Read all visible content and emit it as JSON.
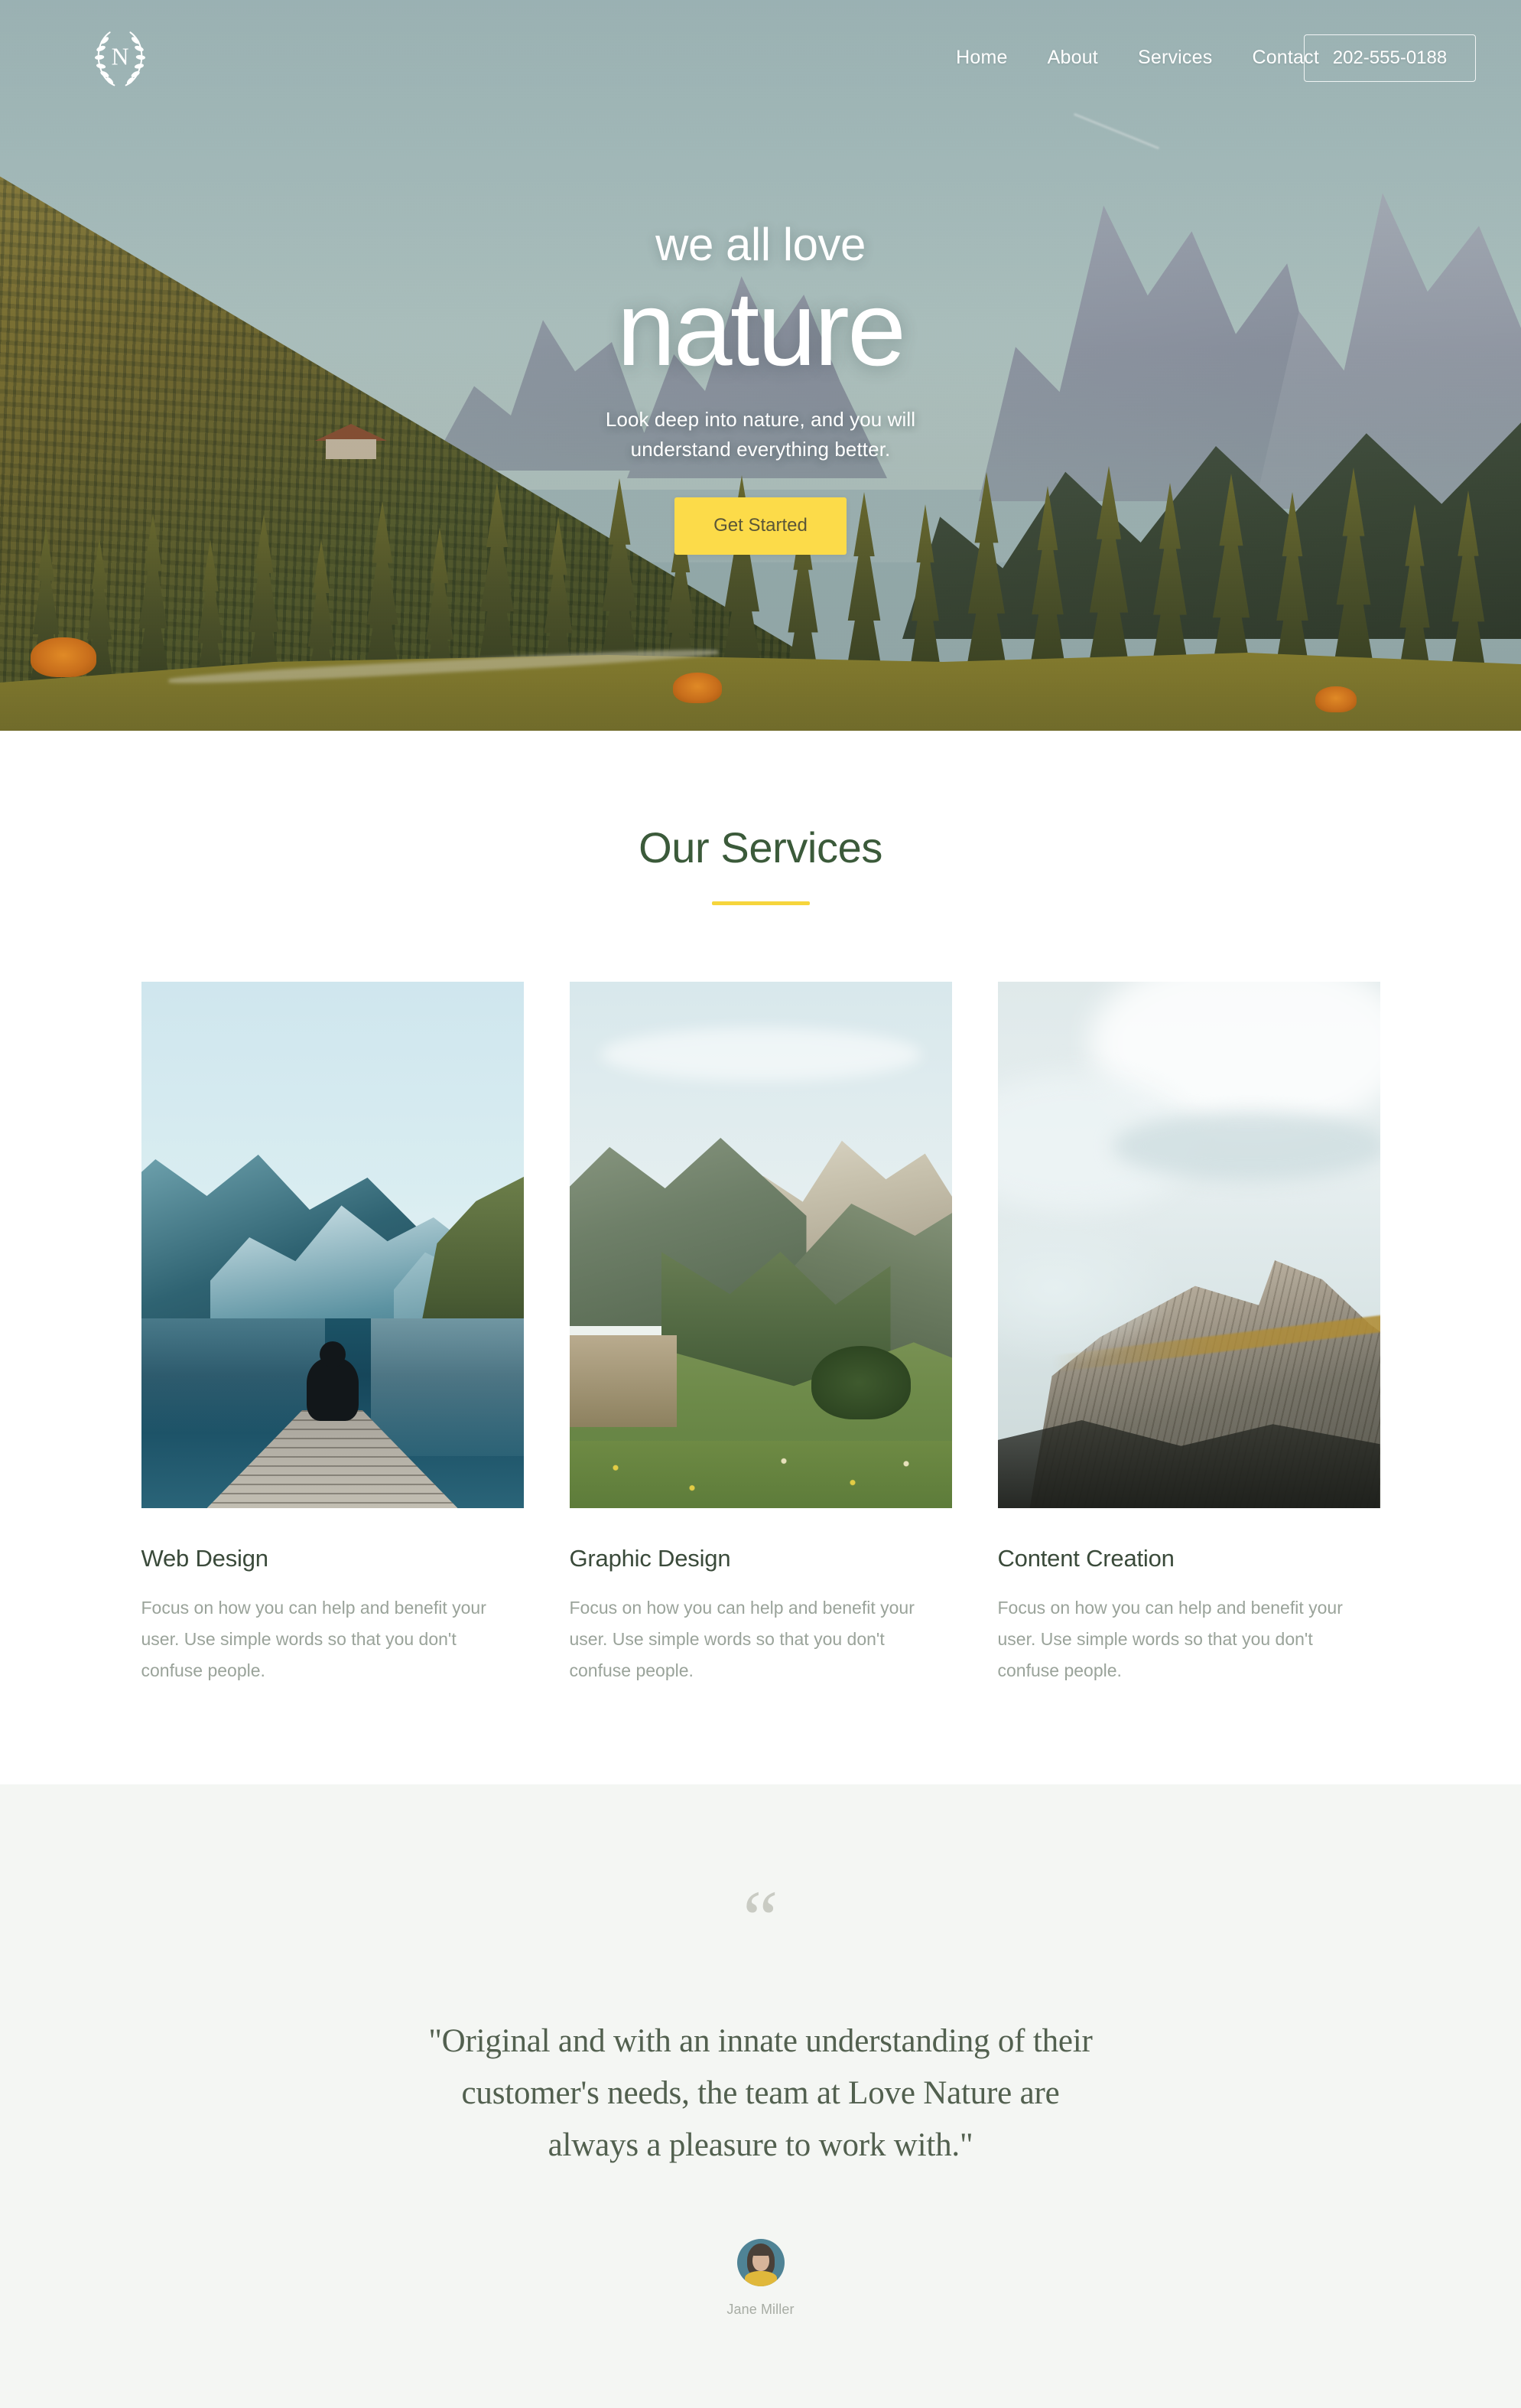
{
  "brand": {
    "logo_letter": "N",
    "logo_icon": "laurel-wreath-icon"
  },
  "nav": {
    "links": [
      {
        "label": "Home"
      },
      {
        "label": "About"
      },
      {
        "label": "Services"
      },
      {
        "label": "Contact"
      }
    ],
    "phone_label": "202-555-0188"
  },
  "hero": {
    "eyebrow": "we all love",
    "headline": "nature",
    "subline_line1": "Look deep into nature, and you will",
    "subline_line2": "understand everything better.",
    "cta_label": "Get Started",
    "cta_color": "#fcdb49",
    "image_alt": "alpine valley with golden larch forest and dolomite peaks"
  },
  "services": {
    "title": "Our Services",
    "rule_color": "#f6d53c",
    "title_color": "#3b5a3a",
    "cards": [
      {
        "title": "Web Design",
        "text": "Focus on how you can help and benefit your user. Use simple words so that you don't confuse people.",
        "image_alt": "person sitting on a wooden dock over a mountain lake"
      },
      {
        "title": "Graphic Design",
        "text": "Focus on how you can help and benefit your user. Use simple words so that you don't confuse people.",
        "image_alt": "green alpine valley with rolling hills"
      },
      {
        "title": "Content Creation",
        "text": "Focus on how you can help and benefit your user. Use simple words so that you don't confuse people.",
        "image_alt": "rocky mountain summit surrounded by clouds"
      }
    ]
  },
  "testimonial": {
    "quote_mark": "“",
    "quote_line1": "\"Original and with an innate understanding of their",
    "quote_line2": "customer's needs, the team at Love Nature are",
    "quote_line3": "always a pleasure to work with.\"",
    "author_name": "Jane Miller",
    "background": "#f4f6f3"
  }
}
